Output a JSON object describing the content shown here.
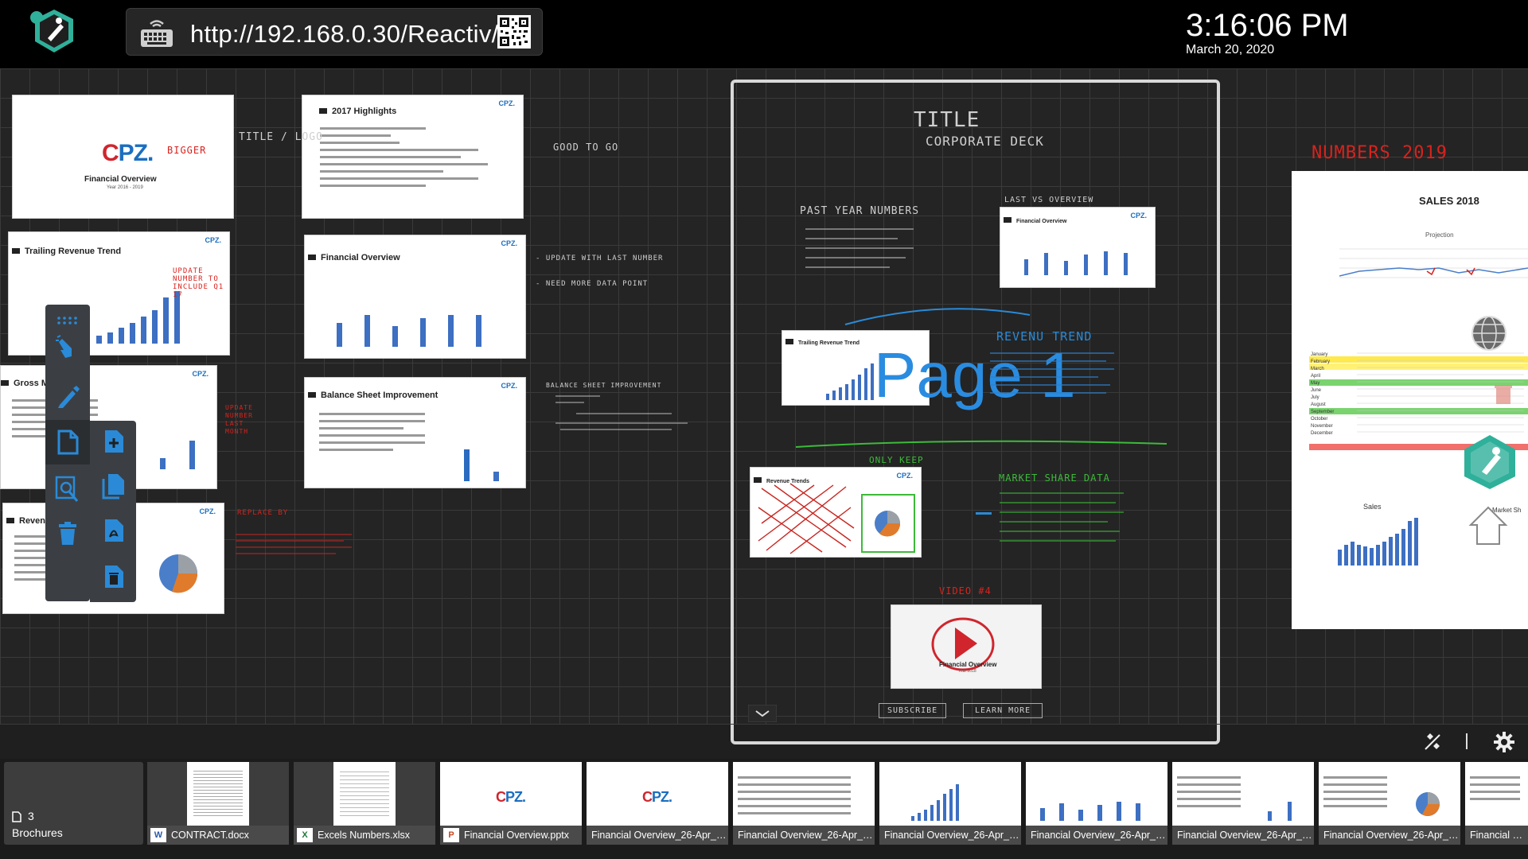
{
  "header": {
    "url": "http://192.168.0.30/Reactiv/",
    "time": "3:16:06 PM",
    "date": "March 20, 2020"
  },
  "canvas": {
    "page_label": "Page  1",
    "slides": {
      "cover_subtitle": "Financial Overview",
      "cover_date": "Year 2016 - 2019",
      "highlights_title": "2017 Highlights",
      "trailing_title": "Trailing Revenue Trend",
      "financial_title": "Financial Overview",
      "gross_title": "Gross M",
      "balance_title": "Balance Sheet Improvement",
      "revenue_title": "Reven",
      "mini_trailing": "Trailing Revenue Trend",
      "mini_financial": "Financial Overview",
      "mini_revenue": "Revenue Trends",
      "video_title": "Financial Overview",
      "video_sub": "Year 2018",
      "logo_text": "CPZ."
    },
    "annotations": {
      "bigger": "BIGGER",
      "title_logo": "TITLE / LOGO",
      "good_to_go": "GOOD TO GO",
      "update_number": "UPDATE NUMBER TO INCLUDE Q1 17",
      "update_latest": "- UPDATE WITH LAST NUMBER",
      "need_more": "- NEED MORE DATA POINT",
      "balance_notes": "BALANCE SHEET IMPROVEMENT",
      "replace": "REPLACE BY",
      "frame_title": "TITLE",
      "frame_sub": "CORPORATE DECK",
      "past_year": "PAST YEAR NUMBERS",
      "last_vs": "LAST VS OVERVIEW",
      "revenue_trend": "REVENU TREND",
      "only_keep": "ONLY KEEP",
      "market_share": "MARKET SHARE DATA",
      "video": "VIDEO #4",
      "subscribe": "SUBSCRIBE",
      "learn_more": "LEARN MORE",
      "numbers": "NUMBERS 2019"
    },
    "sales": {
      "title": "SALES 2018",
      "projection": "Projection",
      "sales_chart": "Sales",
      "market_sh": "Market Sh"
    }
  },
  "tray": {
    "folder": {
      "count": "3",
      "name": "Brochures"
    },
    "items": [
      {
        "label": "CONTRACT.docx",
        "type": "W"
      },
      {
        "label": "Excels Numbers.xlsx",
        "type": "X"
      },
      {
        "label": "Financial Overview.pptx",
        "type": "P"
      },
      {
        "label": "Financial Overview_26-Apr_03-..."
      },
      {
        "label": "Financial Overview_26-Apr_03-...",
        "preview_title": "2017 Highlights"
      },
      {
        "label": "Financial Overview_26-Apr_03-...",
        "preview_title": "Trailing Revenue Trend"
      },
      {
        "label": "Financial Overview_26-Apr_03-...",
        "preview_title": "Financial Overview"
      },
      {
        "label": "Financial Overview_26-Apr_03-...",
        "preview_title": "Gross Margin Trends"
      },
      {
        "label": "Financial Overview_26-Apr_03-...",
        "preview_title": "Revenue Trends"
      },
      {
        "label": "Financial Overv",
        "preview_title": "Balance Sheet Imp"
      }
    ]
  },
  "icons": {
    "app_logo": "pen-hexagon-logo-icon",
    "keyboard": "keyboard-wifi-icon",
    "qr": "qr-code-icon",
    "eraser": "eraser-icon",
    "settings": "gear-icon",
    "accent": "#2a8ce0",
    "annotation_red": "#d7231e",
    "annotation_green": "#3dba3a"
  }
}
